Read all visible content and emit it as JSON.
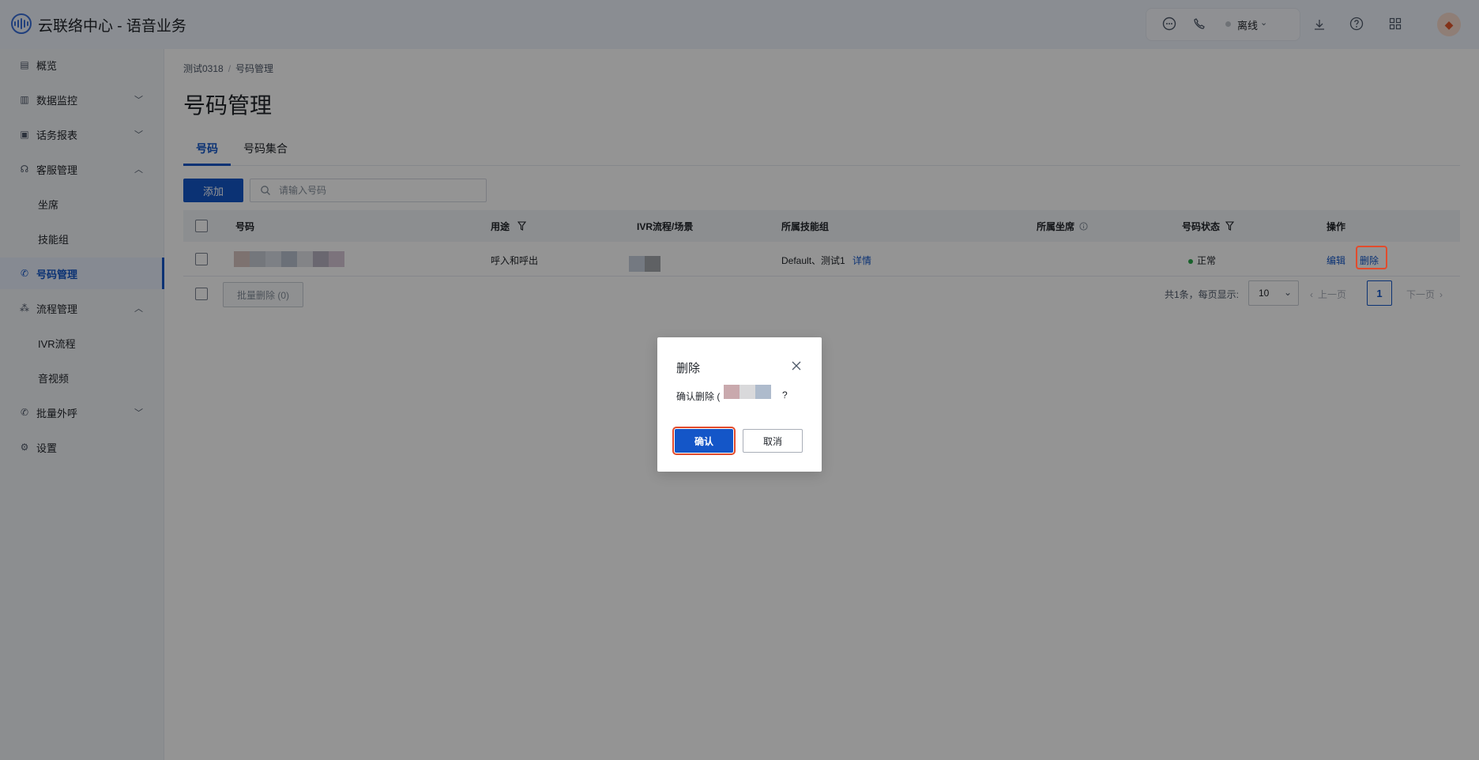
{
  "app": {
    "title": "云联络中心 - 语音业务",
    "status_label": "离线"
  },
  "topbar_icons": [
    "chat-icon",
    "phone-icon",
    "download-icon",
    "help-icon",
    "apps-grid-icon",
    "avatar"
  ],
  "sidebar": {
    "items": [
      {
        "label": "概览",
        "icon": "overview-icon",
        "chevron": ""
      },
      {
        "label": "数据监控",
        "icon": "monitor-icon",
        "chevron": "down"
      },
      {
        "label": "话务报表",
        "icon": "report-icon",
        "chevron": "down"
      },
      {
        "label": "客服管理",
        "icon": "headset-icon",
        "chevron": "up"
      },
      {
        "label": "坐席",
        "icon": "",
        "chevron": ""
      },
      {
        "label": "技能组",
        "icon": "",
        "chevron": ""
      },
      {
        "label": "号码管理",
        "icon": "phone-icon",
        "chevron": "",
        "active": true
      },
      {
        "label": "流程管理",
        "icon": "flow-icon",
        "chevron": "up"
      },
      {
        "label": "IVR流程",
        "icon": "",
        "chevron": ""
      },
      {
        "label": "音视频",
        "icon": "",
        "chevron": ""
      },
      {
        "label": "批量外呼",
        "icon": "outbound-call-icon",
        "chevron": "down"
      },
      {
        "label": "设置",
        "icon": "gear-icon",
        "chevron": ""
      }
    ]
  },
  "breadcrumb": {
    "parent": "测试0318",
    "current": "号码管理"
  },
  "page_title": "号码管理",
  "tabs": [
    {
      "label": "号码",
      "active": true
    },
    {
      "label": "号码集合",
      "active": false
    }
  ],
  "toolbar": {
    "add_label": "添加",
    "search_placeholder": "请输入号码"
  },
  "table": {
    "columns": [
      "号码",
      "用途",
      "IVR流程/场景",
      "所属技能组",
      "所属坐席",
      "号码状态",
      "操作"
    ],
    "rows": [
      {
        "usage": "呼入和呼出",
        "skill_groups": "Default、测试1",
        "details_link": "详情",
        "agent": "",
        "status": "正常",
        "actions": [
          "编辑",
          "删除"
        ]
      }
    ]
  },
  "footer": {
    "batch_delete_label": "批量删除 (0)",
    "total_text": "共1条，每页显示:",
    "page_size": "10",
    "prev_label": "上一页",
    "current_page": "1",
    "next_label": "下一页"
  },
  "modal": {
    "title": "删除",
    "body_prefix": "确认删除 (",
    "body_suffix": "?",
    "confirm_label": "确认",
    "cancel_label": "取消"
  },
  "colors": {
    "accent": "#1456c8",
    "highlight": "#e24b2c",
    "status_ok": "#2aa84a",
    "overlay": "rgba(0,0,0,0.42)"
  }
}
